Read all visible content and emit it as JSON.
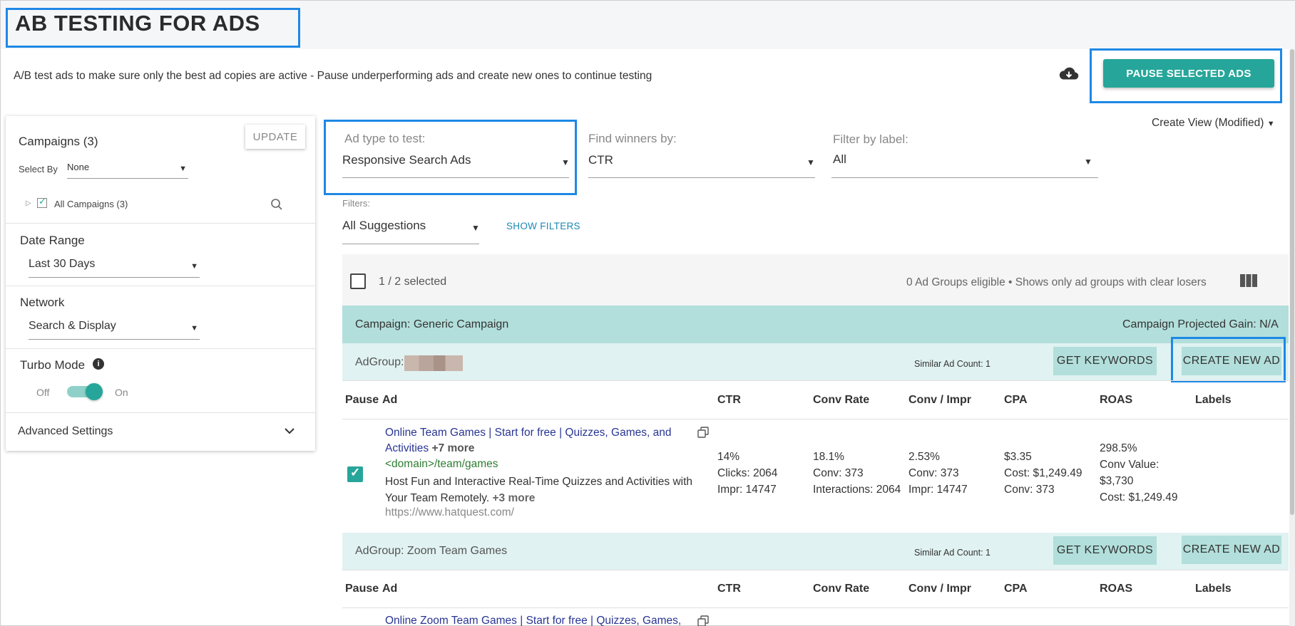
{
  "header": {
    "title": "AB TESTING FOR ADS",
    "subtitle": "A/B test ads to make sure only the best ad copies are active - Pause underperforming ads and create new ones to continue testing",
    "pause_button": "PAUSE SELECTED ADS",
    "download_icon": "cloud-download-icon",
    "create_view": "Create View (Modified)"
  },
  "sidebar": {
    "campaigns_heading": "Campaigns (3)",
    "update_button": "UPDATE",
    "select_by_label": "Select By",
    "select_by_value": "None",
    "all_campaigns": "All Campaigns (3)",
    "date_range_label": "Date Range",
    "date_range_value": "Last 30 Days",
    "network_label": "Network",
    "network_value": "Search & Display",
    "turbo_label": "Turbo Mode",
    "turbo_off": "Off",
    "turbo_on": "On",
    "advanced": "Advanced Settings"
  },
  "filters": {
    "ad_type_label": "Ad type to test:",
    "ad_type_value": "Responsive Search Ads",
    "winners_label": "Find winners by:",
    "winners_value": "CTR",
    "label_label": "Filter by label:",
    "label_value": "All",
    "filters_label": "Filters:",
    "filters_value": "All Suggestions",
    "show_filters": "SHOW FILTERS"
  },
  "toolbar": {
    "selected": "1 / 2 selected",
    "eligible": "0 Ad Groups eligible • Shows only ad groups with clear losers"
  },
  "campaign": {
    "name": "Campaign: Generic Campaign",
    "gain": "Campaign Projected Gain: N/A"
  },
  "columns": [
    "Pause",
    "Ad",
    "CTR",
    "Conv Rate",
    "Conv / Impr",
    "CPA",
    "ROAS",
    "Labels"
  ],
  "adgroups": [
    {
      "label": "AdGroup:",
      "similar": "Similar Ad Count: 1",
      "get_keywords": "GET KEYWORDS",
      "create_ad": "CREATE NEW AD",
      "ad": {
        "headline": "Online Team Games | Start for free | Quizzes, Games, and Activities",
        "headline_more": "+7 more",
        "path": "<domain>/team/games",
        "desc": "Host Fun and Interactive Real-Time Quizzes and Activities with Your Team Remotely.",
        "desc_more": "+3 more",
        "url": "https://www.hatquest.com/",
        "ctr": [
          "14%",
          "Clicks: 2064",
          "Impr: 14747"
        ],
        "conv_rate": [
          "18.1%",
          "Conv: 373",
          "Interactions: 2064"
        ],
        "conv_impr": [
          "2.53%",
          "Conv: 373",
          "Impr: 14747"
        ],
        "cpa": [
          "$3.35",
          "Cost: $1,249.49",
          "Conv: 373"
        ],
        "roas": [
          "298.5%",
          "Conv Value:",
          "$3,730",
          "Cost: $1,249.49"
        ]
      }
    },
    {
      "label": "AdGroup: Zoom Team Games",
      "similar": "Similar Ad Count: 1",
      "get_keywords": "GET KEYWORDS",
      "create_ad": "CREATE NEW AD",
      "ad": {
        "headline": "Online Zoom Team Games | Start for free | Quizzes, Games,"
      }
    }
  ],
  "colors": {
    "accent": "#26a69a",
    "highlight": "#1e88e5",
    "campaign_bar": "#b2dfdb",
    "adgroup_bar": "#e0f2f1"
  }
}
